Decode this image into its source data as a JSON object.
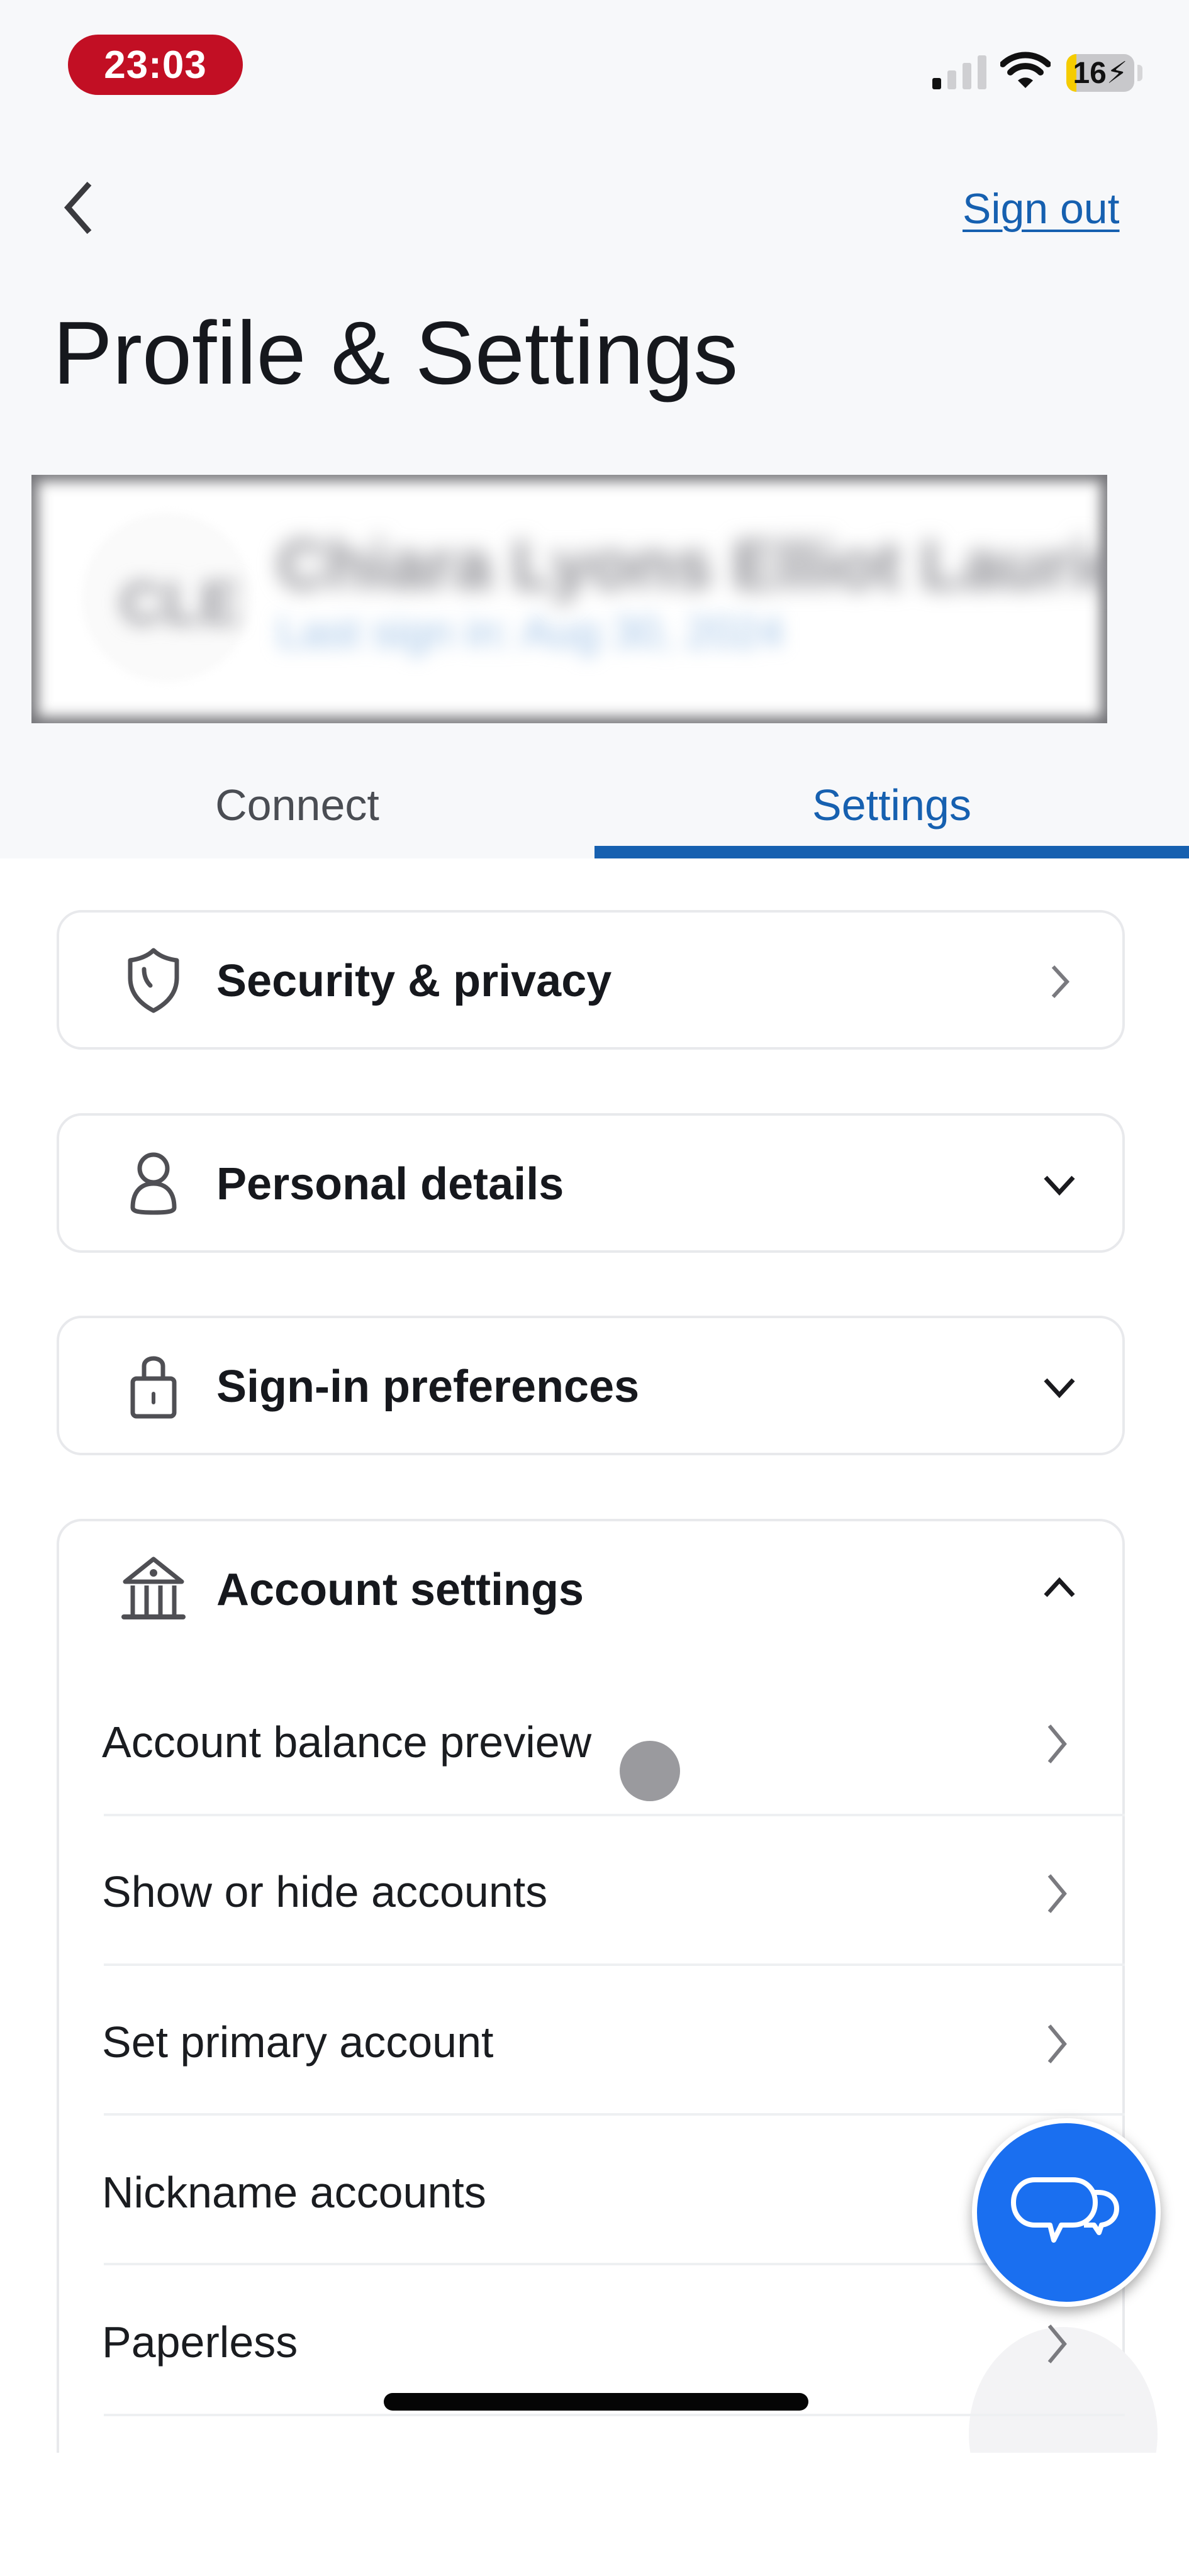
{
  "status_bar": {
    "time": "23:03",
    "battery_level": "16",
    "battery_charging": true,
    "signal_bars_active": 1,
    "signal_bars_total": 4,
    "wifi": "connected"
  },
  "header": {
    "back_icon": "chevron-left-icon",
    "sign_out_label": "Sign out",
    "title": "Profile & Settings"
  },
  "profile": {
    "initials": "CLE",
    "name": "Chiara Lyons Elliot Laurie",
    "last_sign_in": "Last sign in: Aug 30, 2024",
    "redacted": true
  },
  "tabs": [
    {
      "label": "Connect",
      "active": false
    },
    {
      "label": "Settings",
      "active": true
    }
  ],
  "sections": [
    {
      "label": "Security & privacy",
      "icon": "shield-icon",
      "indicator": "chevron-right"
    },
    {
      "label": "Personal details",
      "icon": "person-icon",
      "indicator": "chevron-down"
    },
    {
      "label": "Sign-in preferences",
      "icon": "lock-icon",
      "indicator": "chevron-down"
    },
    {
      "label": "Account settings",
      "icon": "bank-icon",
      "indicator": "chevron-up",
      "expanded": true
    }
  ],
  "account_settings_items": [
    {
      "label": "Account balance preview"
    },
    {
      "label": "Show or hide accounts"
    },
    {
      "label": "Set primary account"
    },
    {
      "label": "Nickname accounts"
    },
    {
      "label": "Paperless"
    }
  ],
  "chat_button": {
    "icon": "chat-bubbles-icon",
    "color": "#1a6ff0"
  },
  "colors": {
    "accent": "#1660b0",
    "time_pill": "#c20f24",
    "battery_level": "#f5cc00"
  }
}
